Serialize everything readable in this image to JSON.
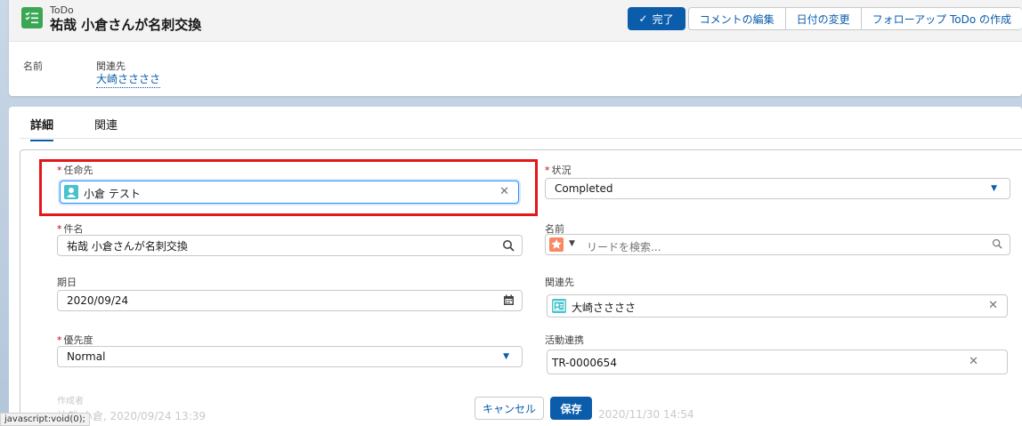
{
  "header": {
    "object_label": "ToDo",
    "record_title": "祐哉 小倉さんが名刺交換",
    "buttons": {
      "complete": "完了",
      "edit_comment": "コメントの編集",
      "change_date": "日付の変更",
      "followup": "フォローアップ ToDo の作成"
    },
    "highlights": {
      "name_label": "名前",
      "related_label": "関連先",
      "related_value": "大崎ささささ"
    }
  },
  "tabs": {
    "detail": "詳細",
    "related": "関連"
  },
  "form": {
    "assigned_to": {
      "label": "任命先",
      "value": "小倉 テスト"
    },
    "status": {
      "label": "状況",
      "value": "Completed"
    },
    "subject": {
      "label": "件名",
      "value": "祐哉 小倉さんが名刺交換"
    },
    "name": {
      "label": "名前",
      "placeholder": "リードを検索..."
    },
    "due_date": {
      "label": "期日",
      "value": "2020/09/24"
    },
    "related_to": {
      "label": "関連先",
      "value": "大崎ささささ"
    },
    "priority": {
      "label": "優先度",
      "value": "Normal"
    },
    "activity_link": {
      "label": "活動連携",
      "value": "TR-0000654"
    },
    "created_by": {
      "label": "作成者",
      "value": "祐哉 小倉, 2020/09/24 13:39"
    },
    "modified_tail": "2020/11/30 14:54"
  },
  "footer": {
    "cancel": "キャンセル",
    "save": "保存"
  },
  "status_bar": "javascript:void(0);",
  "colors": {
    "brand": "#0b5cab",
    "todo_icon": "#3ba755",
    "highlight": "#e3161b",
    "user_icon": "#48c3cc",
    "lead_icon": "#f88962"
  }
}
